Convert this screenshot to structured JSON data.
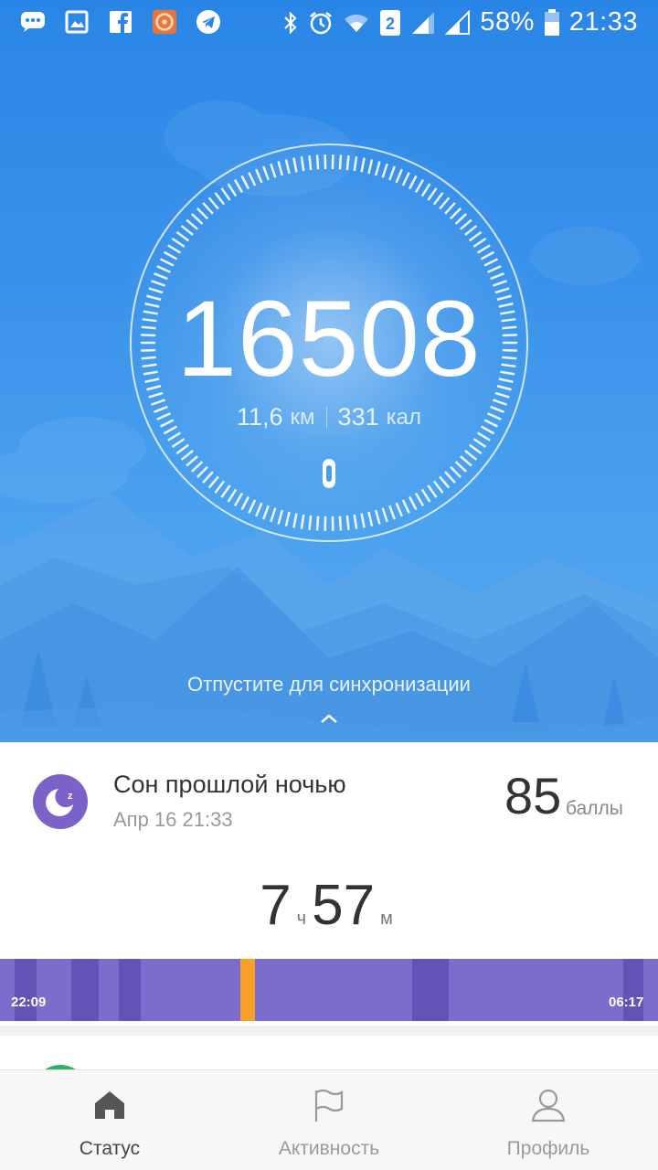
{
  "status_bar": {
    "battery": "58%",
    "time": "21:33",
    "sim": "2",
    "left_icons": [
      "messages-icon",
      "gallery-icon",
      "facebook-icon",
      "app-icon",
      "telegram-icon"
    ],
    "right_icons": [
      "bluetooth-icon",
      "alarm-icon",
      "wifi-icon",
      "sim-icon",
      "signal-icon",
      "signal2-icon",
      "battery-icon"
    ]
  },
  "hero": {
    "steps": "16508",
    "distance_value": "11,6",
    "distance_unit": "км",
    "calories_value": "331",
    "calories_unit": "кал",
    "sync_hint": "Отпустите для синхронизации"
  },
  "sleep_card": {
    "title": "Сон прошлой ночью",
    "date": "Апр 16 21:33",
    "score": "85",
    "score_unit": "баллы",
    "hours": "7",
    "hours_unit": "ч",
    "minutes": "57",
    "minutes_unit": "м",
    "start_time": "22:09",
    "end_time": "06:17",
    "colors": {
      "light": "#7c6ccc",
      "deep": "#6552b7",
      "awake": "#f5a12b",
      "badge": "#7b62c9"
    }
  },
  "bottom_nav": {
    "items": [
      {
        "label": "Статус",
        "icon": "home-icon",
        "active": true
      },
      {
        "label": "Активность",
        "icon": "flag-icon",
        "active": false
      },
      {
        "label": "Профиль",
        "icon": "profile-icon",
        "active": false
      }
    ]
  }
}
